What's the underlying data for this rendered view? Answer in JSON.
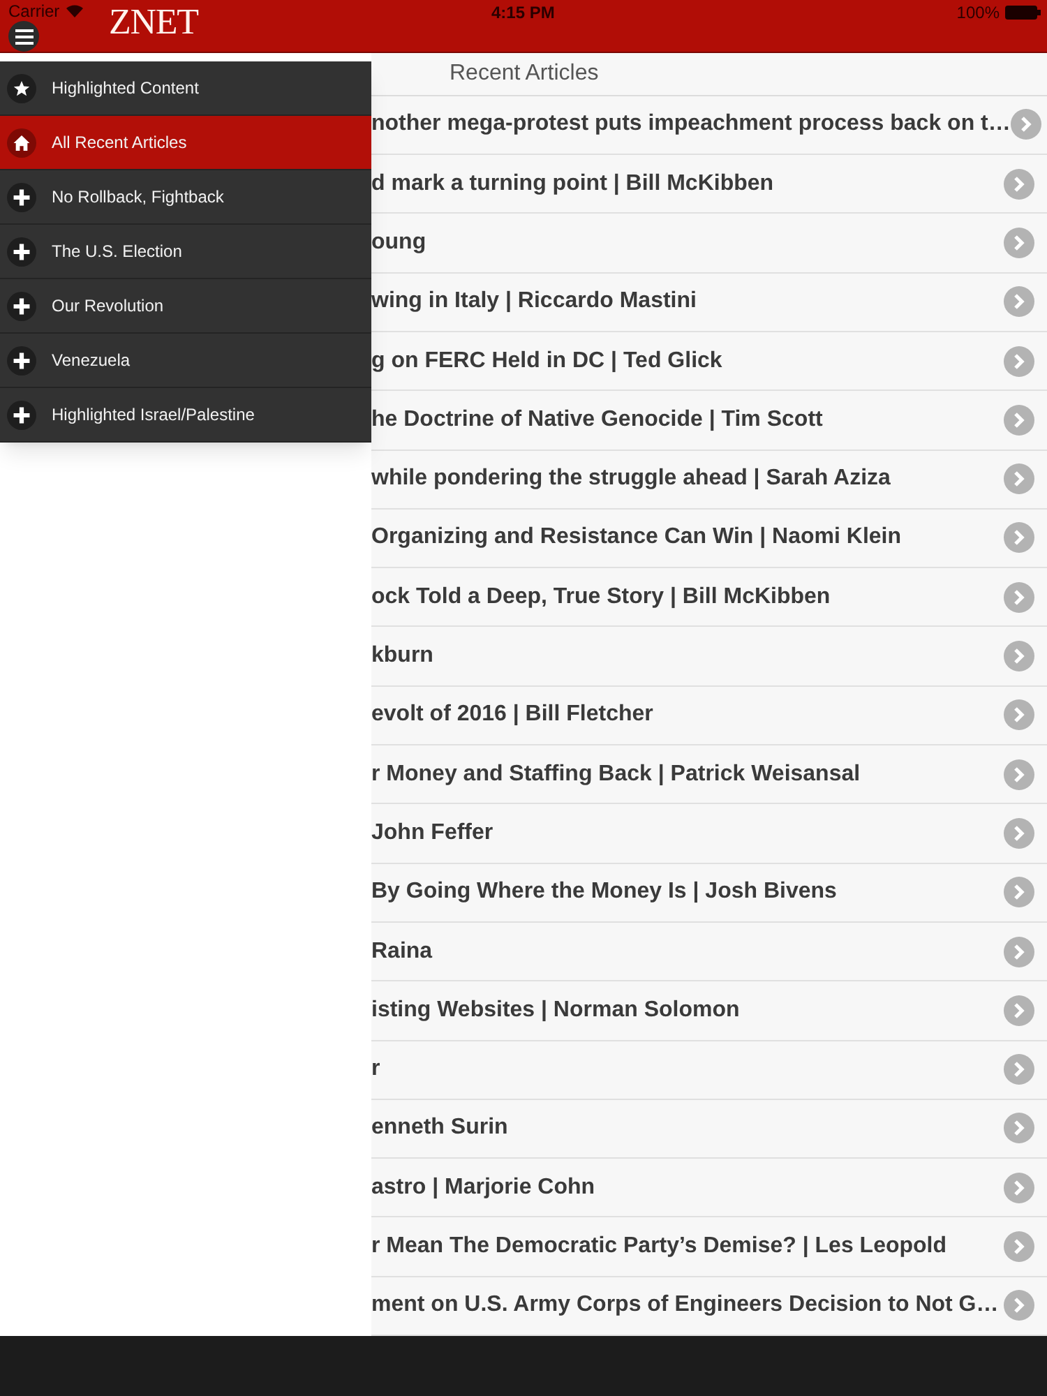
{
  "status_bar": {
    "carrier": "Carrier",
    "time": "4:15 PM",
    "battery": "100%"
  },
  "app_bar": {
    "logo": "ZNET"
  },
  "menu": [
    {
      "label": "Highlighted Content",
      "kind": "featured",
      "selected": false
    },
    {
      "label": "All Recent Articles",
      "kind": "home",
      "selected": true
    },
    {
      "label": "No Rollback, Fightback",
      "kind": "category",
      "selected": false
    },
    {
      "label": "The U.S. Election",
      "kind": "category",
      "selected": false
    },
    {
      "label": "Our Revolution",
      "kind": "category",
      "selected": false
    },
    {
      "label": "Venezuela",
      "kind": "category",
      "selected": false
    },
    {
      "label": "Highlighted Israel/Palestine",
      "kind": "category",
      "selected": false
    }
  ],
  "list": {
    "title": "Recent Articles",
    "rows": [
      "nother mega-protest puts impeachment process back on t…",
      "d mark a turning point | Bill McKibben",
      "oung",
      "wing in Italy | Riccardo Mastini",
      "g on FERC Held in DC | Ted Glick",
      "he Doctrine of Native Genocide | Tim Scott",
      "while pondering the struggle ahead | Sarah Aziza",
      "Organizing and Resistance Can Win | Naomi Klein",
      "ock Told a Deep, True Story | Bill McKibben",
      "kburn",
      "evolt of 2016 | Bill Fletcher",
      "r Money and Staffing Back | Patrick Weisansal",
      "John Feffer",
      "By Going Where the Money Is | Josh Bivens",
      "Raina",
      "isting Websites | Norman Solomon",
      "r",
      "enneth Surin",
      "astro | Marjorie Cohn",
      "r Mean The Democratic Party’s Demise? | Les Leopold",
      "ment on U.S. Army Corps of Engineers Decision to Not G…"
    ]
  }
}
